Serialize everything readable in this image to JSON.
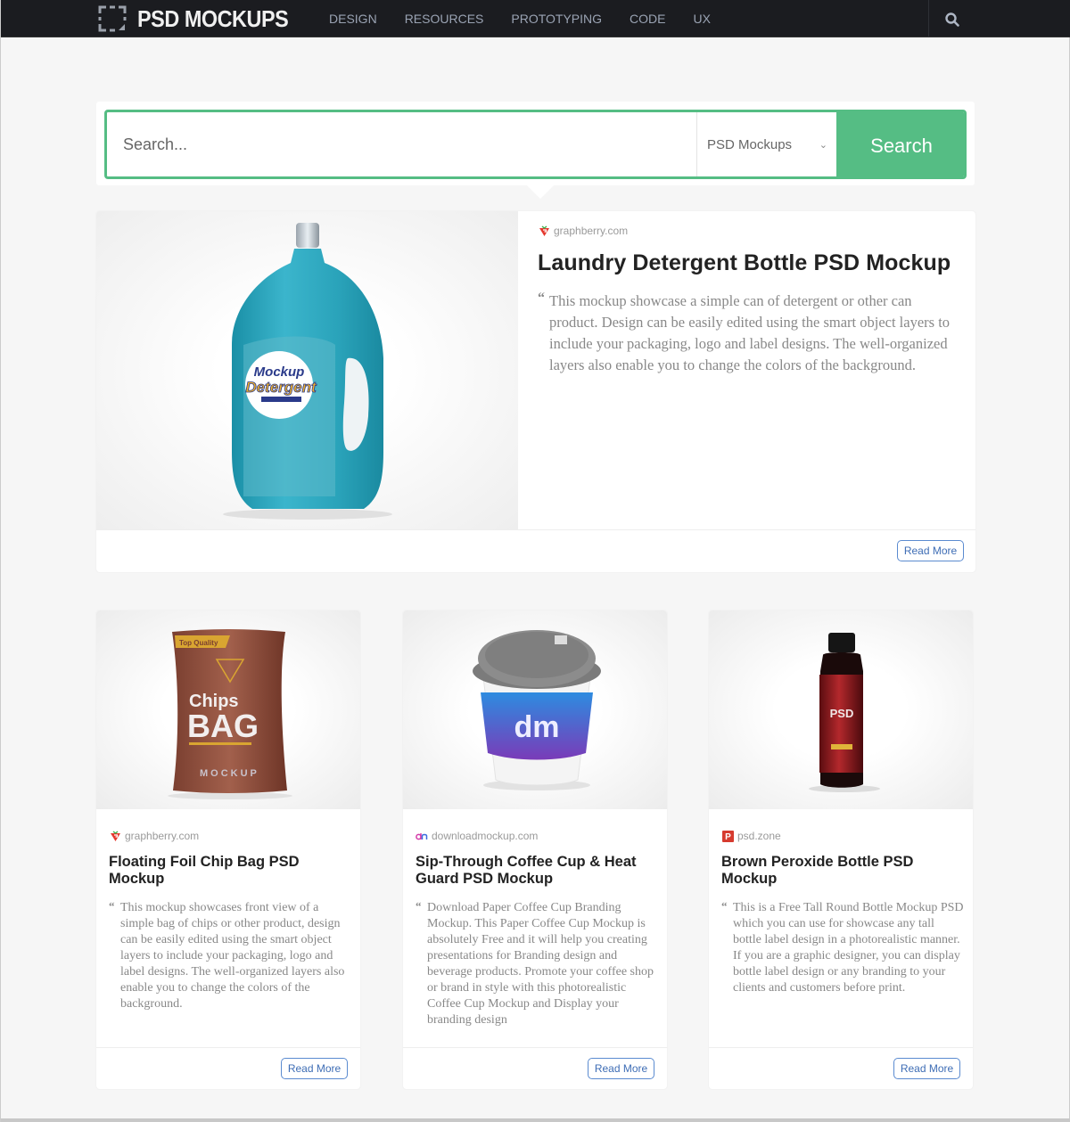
{
  "header": {
    "logo_text": "PSD MOCKUPS",
    "nav": [
      "DESIGN",
      "RESOURCES",
      "PROTOTYPING",
      "CODE",
      "UX"
    ],
    "search_icon": "search-icon"
  },
  "search": {
    "placeholder": "Search...",
    "category_selected": "PSD Mockups",
    "button_label": "Search",
    "accent_color": "#55bd84"
  },
  "featured": {
    "source": "graphberry.com",
    "source_icon": "graphberry-icon",
    "title": "Laundry Detergent Bottle PSD Mockup",
    "description": "This mockup showcase a simple can of detergent or other can product. Design can be easily edited using the smart object layers to include your packaging, logo and label designs. The well-organized layers also enable you to change the colors of the background.",
    "image_alt": "Laundry detergent bottle mockup",
    "read_more": "Read More"
  },
  "cards": [
    {
      "source": "graphberry.com",
      "source_icon": "graphberry-icon",
      "title": "Floating Foil Chip Bag PSD Mockup",
      "description": "This mockup showcases front view of a simple bag of chips or other product, design can be easily edited using the smart object layers to include your packaging, logo and label designs. The well-organized layers also enable you to change the colors of the background.",
      "image_alt": "Chips bag mockup",
      "read_more": "Read More"
    },
    {
      "source": "downloadmockup.com",
      "source_icon": "downloadmockup-icon",
      "title": "Sip-Through Coffee Cup & Heat Guard PSD Mockup",
      "description": "Download Paper Coffee Cup Branding Mockup. This Paper Coffee Cup Mockup is absolutely Free and it will help you creating presentations for Branding design and beverage products. Promote your coffee shop or brand in style with this photorealistic Coffee Cup Mockup and Display your branding design",
      "image_alt": "Coffee cup mockup",
      "read_more": "Read More"
    },
    {
      "source": "psd.zone",
      "source_icon": "psdzone-icon",
      "title": "Brown Peroxide Bottle PSD Mockup",
      "description": "This is a Free Tall Round Bottle Mockup PSD which you can use for showcase any tall bottle label design in a photorealistic manner. If you are a graphic designer, you can display bottle label design or any branding to your clients and customers before print.",
      "image_alt": "Tall round bottle mockup",
      "read_more": "Read More"
    }
  ],
  "image_labels": {
    "detergent_1": "Mockup",
    "detergent_2": "Detergent",
    "chips_1": "Chips",
    "chips_2": "BAG",
    "chips_3": "MOCKUP",
    "chips_badge": "Top Quality",
    "cup_logo": "dm",
    "bottle_logo": "PSD"
  }
}
